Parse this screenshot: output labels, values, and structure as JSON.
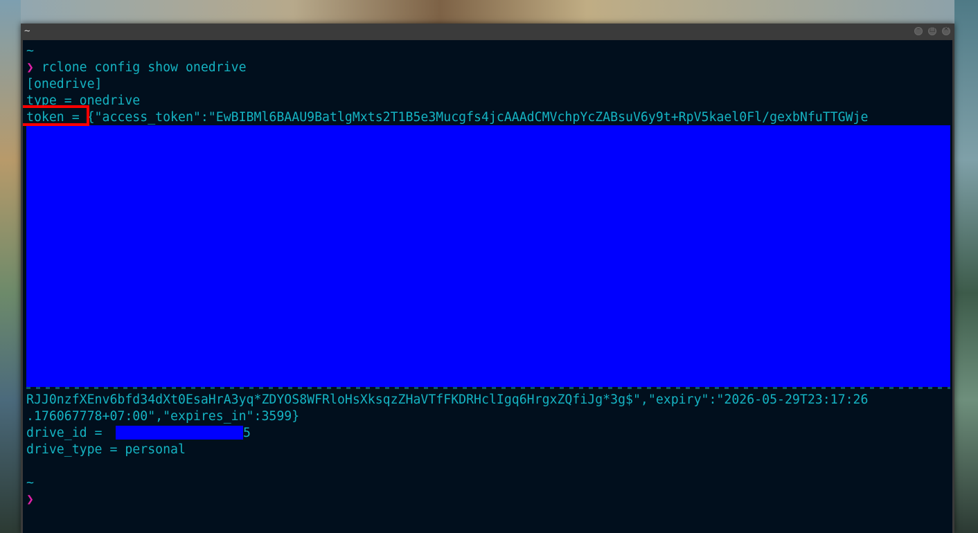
{
  "window": {
    "title": "~"
  },
  "terminal": {
    "lines": [
      {
        "text": "~"
      },
      {
        "prompt": "❯",
        "text": " rclone config show onedrive"
      },
      {
        "text": "[onedrive]"
      },
      {
        "text": "type = onedrive"
      },
      {
        "text": "token = {\"access_token\":\"EwBIBMl6BAAU9BatlgMxts2T1B5e3Mucgfs4jcAAAdCMVchpYcZABsuV6y9t+RpV5kael0Fl/gexbNfuTTGWje"
      },
      {
        "text": "RJJ0nzfXEnv6bfd34dXt0EsaHrA3yq*ZDYOS8WFRloHsXksqzZHaVTfFKDRHclIgq6HrgxZQfiJg*3g$\",\"expiry\":\"2026-05-29T23:17:26"
      },
      {
        "text": ".176067778+07:00\",\"expires_in\":3599}"
      },
      {
        "text": "drive_id = "
      },
      {
        "text": "5"
      },
      {
        "text": "drive_type = personal"
      },
      {
        "text": "~"
      },
      {
        "prompt": "❯",
        "text": ""
      }
    ]
  },
  "colors": {
    "terminal_bg": "#010f1d",
    "text": "#15b3c2",
    "prompt": "#e021a8",
    "redaction": "#0000ff",
    "highlight": "#ff0000"
  }
}
